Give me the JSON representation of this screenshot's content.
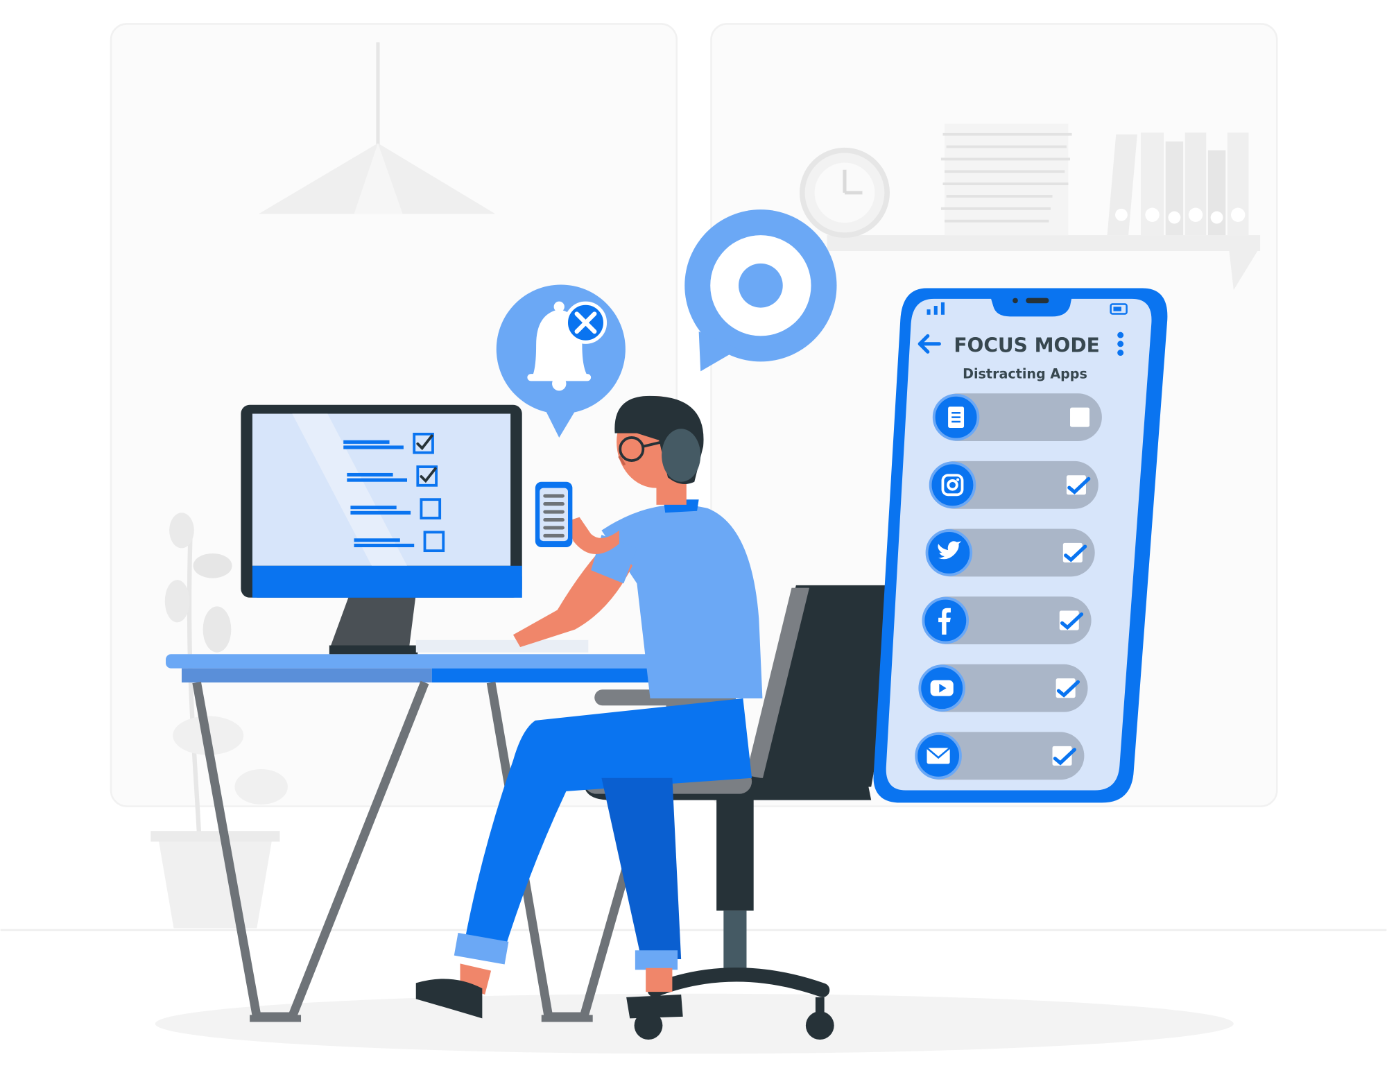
{
  "colors": {
    "accent": "#0A74F0",
    "accent_light": "#6BA8F5",
    "dark": "#263238",
    "grey": "#6E7378",
    "skin": "#F0866A",
    "phone_screen": "#D7E5FA",
    "toggle_track": "#AAB6C8",
    "background_panel": "#FBFBFB"
  },
  "icons": {
    "bell_off": "bell-off-icon",
    "target": "target-icon",
    "back": "back-arrow-icon",
    "more": "more-vertical-icon",
    "signal": "signal-icon",
    "battery": "battery-icon"
  },
  "phone": {
    "title": "FOCUS MODE",
    "subtitle": "Distracting Apps",
    "apps": [
      {
        "name": "notes",
        "icon": "document-icon",
        "checked": false
      },
      {
        "name": "instagram",
        "icon": "instagram-icon",
        "checked": true
      },
      {
        "name": "twitter",
        "icon": "twitter-icon",
        "checked": true
      },
      {
        "name": "facebook",
        "icon": "facebook-icon",
        "checked": true
      },
      {
        "name": "youtube",
        "icon": "youtube-icon",
        "checked": true
      },
      {
        "name": "mail",
        "icon": "mail-icon",
        "checked": true
      }
    ]
  },
  "monitor": {
    "tasks": [
      {
        "checked": true
      },
      {
        "checked": true
      },
      {
        "checked": false
      },
      {
        "checked": false
      }
    ]
  }
}
